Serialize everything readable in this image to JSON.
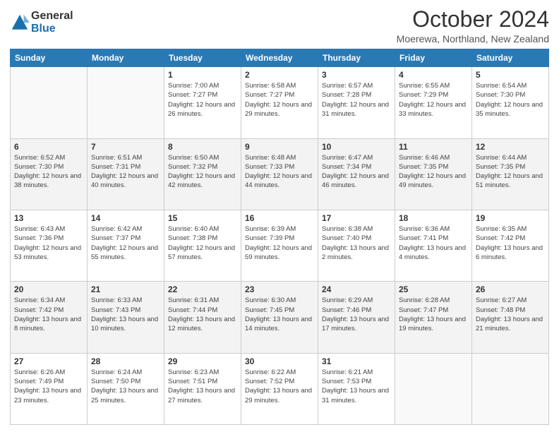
{
  "logo": {
    "general": "General",
    "blue": "Blue"
  },
  "title": "October 2024",
  "subtitle": "Moerewa, Northland, New Zealand",
  "days_of_week": [
    "Sunday",
    "Monday",
    "Tuesday",
    "Wednesday",
    "Thursday",
    "Friday",
    "Saturday"
  ],
  "weeks": [
    [
      {
        "day": "",
        "info": ""
      },
      {
        "day": "",
        "info": ""
      },
      {
        "day": "1",
        "info": "Sunrise: 7:00 AM\nSunset: 7:27 PM\nDaylight: 12 hours and 26 minutes."
      },
      {
        "day": "2",
        "info": "Sunrise: 6:58 AM\nSunset: 7:27 PM\nDaylight: 12 hours and 29 minutes."
      },
      {
        "day": "3",
        "info": "Sunrise: 6:57 AM\nSunset: 7:28 PM\nDaylight: 12 hours and 31 minutes."
      },
      {
        "day": "4",
        "info": "Sunrise: 6:55 AM\nSunset: 7:29 PM\nDaylight: 12 hours and 33 minutes."
      },
      {
        "day": "5",
        "info": "Sunrise: 6:54 AM\nSunset: 7:30 PM\nDaylight: 12 hours and 35 minutes."
      }
    ],
    [
      {
        "day": "6",
        "info": "Sunrise: 6:52 AM\nSunset: 7:30 PM\nDaylight: 12 hours and 38 minutes."
      },
      {
        "day": "7",
        "info": "Sunrise: 6:51 AM\nSunset: 7:31 PM\nDaylight: 12 hours and 40 minutes."
      },
      {
        "day": "8",
        "info": "Sunrise: 6:50 AM\nSunset: 7:32 PM\nDaylight: 12 hours and 42 minutes."
      },
      {
        "day": "9",
        "info": "Sunrise: 6:48 AM\nSunset: 7:33 PM\nDaylight: 12 hours and 44 minutes."
      },
      {
        "day": "10",
        "info": "Sunrise: 6:47 AM\nSunset: 7:34 PM\nDaylight: 12 hours and 46 minutes."
      },
      {
        "day": "11",
        "info": "Sunrise: 6:46 AM\nSunset: 7:35 PM\nDaylight: 12 hours and 49 minutes."
      },
      {
        "day": "12",
        "info": "Sunrise: 6:44 AM\nSunset: 7:35 PM\nDaylight: 12 hours and 51 minutes."
      }
    ],
    [
      {
        "day": "13",
        "info": "Sunrise: 6:43 AM\nSunset: 7:36 PM\nDaylight: 12 hours and 53 minutes."
      },
      {
        "day": "14",
        "info": "Sunrise: 6:42 AM\nSunset: 7:37 PM\nDaylight: 12 hours and 55 minutes."
      },
      {
        "day": "15",
        "info": "Sunrise: 6:40 AM\nSunset: 7:38 PM\nDaylight: 12 hours and 57 minutes."
      },
      {
        "day": "16",
        "info": "Sunrise: 6:39 AM\nSunset: 7:39 PM\nDaylight: 12 hours and 59 minutes."
      },
      {
        "day": "17",
        "info": "Sunrise: 6:38 AM\nSunset: 7:40 PM\nDaylight: 13 hours and 2 minutes."
      },
      {
        "day": "18",
        "info": "Sunrise: 6:36 AM\nSunset: 7:41 PM\nDaylight: 13 hours and 4 minutes."
      },
      {
        "day": "19",
        "info": "Sunrise: 6:35 AM\nSunset: 7:42 PM\nDaylight: 13 hours and 6 minutes."
      }
    ],
    [
      {
        "day": "20",
        "info": "Sunrise: 6:34 AM\nSunset: 7:42 PM\nDaylight: 13 hours and 8 minutes."
      },
      {
        "day": "21",
        "info": "Sunrise: 6:33 AM\nSunset: 7:43 PM\nDaylight: 13 hours and 10 minutes."
      },
      {
        "day": "22",
        "info": "Sunrise: 6:31 AM\nSunset: 7:44 PM\nDaylight: 13 hours and 12 minutes."
      },
      {
        "day": "23",
        "info": "Sunrise: 6:30 AM\nSunset: 7:45 PM\nDaylight: 13 hours and 14 minutes."
      },
      {
        "day": "24",
        "info": "Sunrise: 6:29 AM\nSunset: 7:46 PM\nDaylight: 13 hours and 17 minutes."
      },
      {
        "day": "25",
        "info": "Sunrise: 6:28 AM\nSunset: 7:47 PM\nDaylight: 13 hours and 19 minutes."
      },
      {
        "day": "26",
        "info": "Sunrise: 6:27 AM\nSunset: 7:48 PM\nDaylight: 13 hours and 21 minutes."
      }
    ],
    [
      {
        "day": "27",
        "info": "Sunrise: 6:26 AM\nSunset: 7:49 PM\nDaylight: 13 hours and 23 minutes."
      },
      {
        "day": "28",
        "info": "Sunrise: 6:24 AM\nSunset: 7:50 PM\nDaylight: 13 hours and 25 minutes."
      },
      {
        "day": "29",
        "info": "Sunrise: 6:23 AM\nSunset: 7:51 PM\nDaylight: 13 hours and 27 minutes."
      },
      {
        "day": "30",
        "info": "Sunrise: 6:22 AM\nSunset: 7:52 PM\nDaylight: 13 hours and 29 minutes."
      },
      {
        "day": "31",
        "info": "Sunrise: 6:21 AM\nSunset: 7:53 PM\nDaylight: 13 hours and 31 minutes."
      },
      {
        "day": "",
        "info": ""
      },
      {
        "day": "",
        "info": ""
      }
    ]
  ]
}
